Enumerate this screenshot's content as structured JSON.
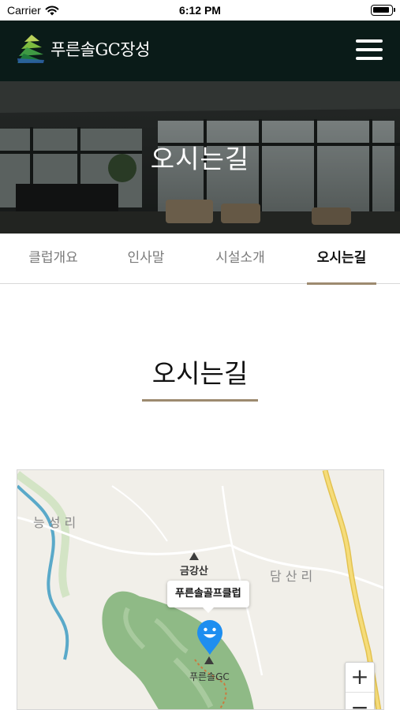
{
  "status_bar": {
    "carrier": "Carrier",
    "time": "6:12 PM",
    "icons": [
      "wifi-icon",
      "battery-icon"
    ]
  },
  "header": {
    "logo_text": "푸른솔GC장성",
    "menu_icon": "hamburger-menu-icon"
  },
  "hero": {
    "title": "오시는길"
  },
  "tabs": [
    {
      "label": "클럽개요",
      "active": false
    },
    {
      "label": "인사말",
      "active": false
    },
    {
      "label": "시설소개",
      "active": false
    },
    {
      "label": "오시는길",
      "active": true
    }
  ],
  "section": {
    "title": "오시는길"
  },
  "map": {
    "labels": {
      "village_1": "능성리",
      "mountain": "금강산",
      "village_2": "담산리",
      "place": "푸른솔GC"
    },
    "callout": "푸른솔골프클럽",
    "zoom_in": "+",
    "zoom_out": "−",
    "marker_icon": "smiley-map-pin-icon",
    "colors": {
      "golf_course": "#8fba86",
      "road": "#f2d770",
      "river": "#5aa9c9",
      "pin": "#1e8ef0"
    }
  },
  "colors": {
    "header_bg": "#0a1b18",
    "accent": "#9d8a6f"
  }
}
